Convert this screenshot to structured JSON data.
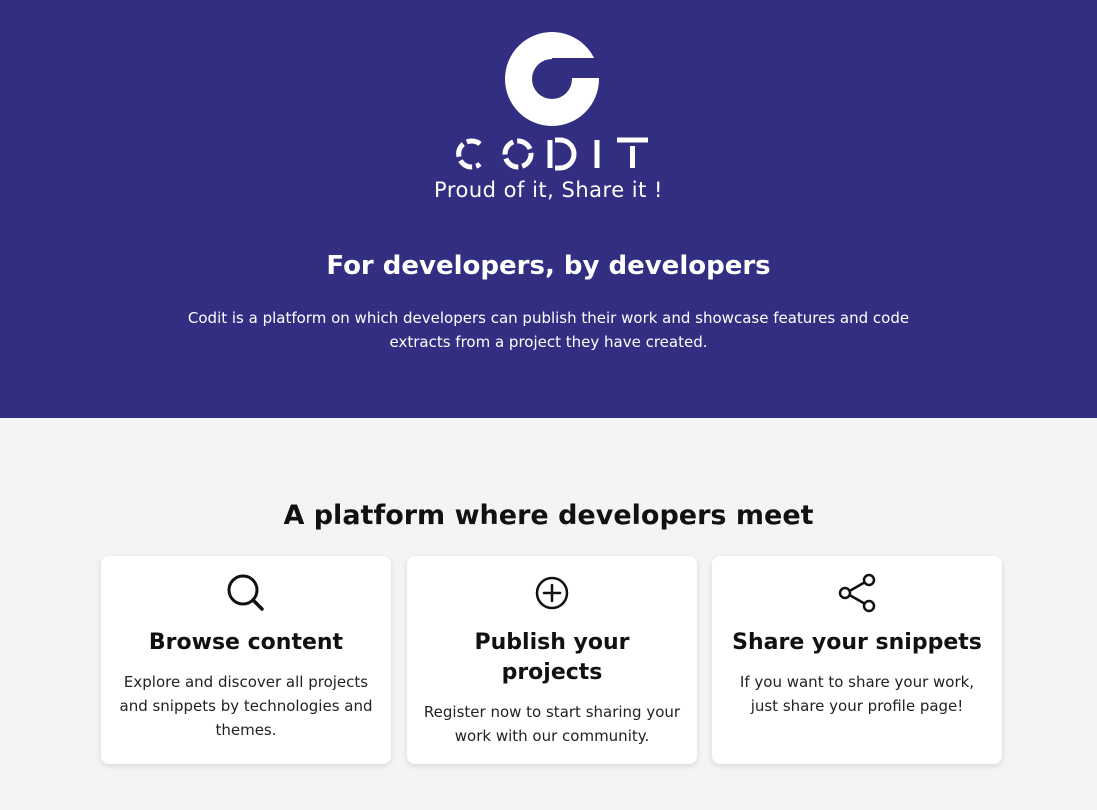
{
  "brand": {
    "logo_text": "CODIT",
    "tagline": "Proud of it, Share it !"
  },
  "hero": {
    "heading": "For developers, by developers",
    "description": "Codit is a platform on which developers can publish their work and showcase features and code extracts from a project they have created."
  },
  "features": {
    "heading": "A platform where developers meet",
    "cards": [
      {
        "icon": "search-icon",
        "title": "Browse content",
        "text": "Explore and discover all projects and snippets by technologies and themes."
      },
      {
        "icon": "plus-circle-icon",
        "title": "Publish your projects",
        "text": "Register now to start sharing your work with our community."
      },
      {
        "icon": "share-icon",
        "title": "Share your snippets",
        "text": "If you want to share your work, just share your profile page!"
      }
    ]
  },
  "colors": {
    "hero_background": "#322e81",
    "page_background": "#f4f4f4",
    "card_background": "#ffffff"
  }
}
